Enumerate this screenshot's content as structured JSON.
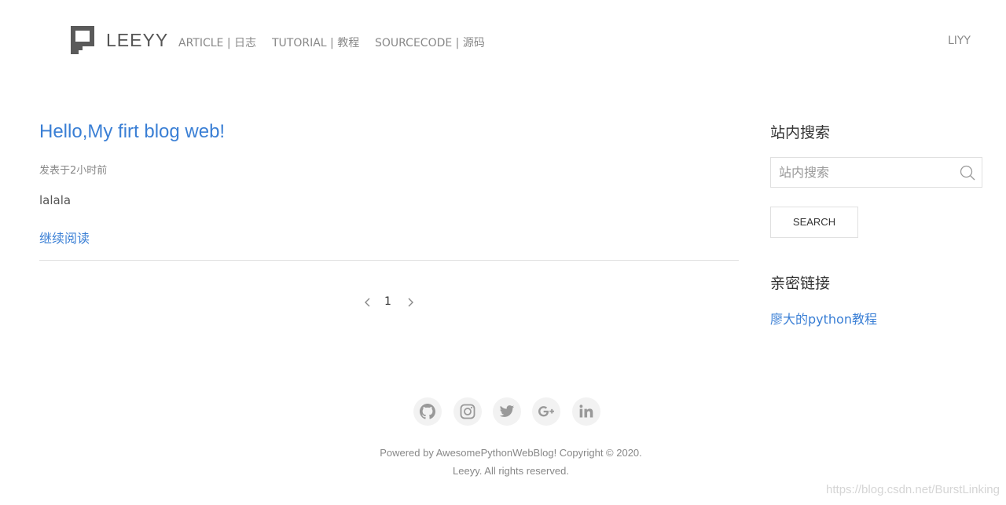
{
  "header": {
    "brand": "LEEYY",
    "nav": [
      {
        "label": "ARTICLE | 日志"
      },
      {
        "label": "TUTORIAL | 教程"
      },
      {
        "label": "SOURCECODE | 源码"
      }
    ],
    "user": "LIYY"
  },
  "article": {
    "title": "Hello,My firt blog web!",
    "meta": "发表于2小时前",
    "summary": "lalala",
    "read_more": "继续阅读"
  },
  "pagination": {
    "current": "1"
  },
  "sidebar": {
    "search_heading": "站内搜索",
    "search_placeholder": "站内搜索",
    "search_button": "SEARCH",
    "links_heading": "亲密链接",
    "links": [
      {
        "label": "廖大的python教程"
      }
    ]
  },
  "footer": {
    "social_icons": [
      "github-icon",
      "instagram-icon",
      "twitter-icon",
      "google-plus-icon",
      "linkedin-icon"
    ],
    "copyright_line1": "Powered by AwesomePythonWebBlog! Copyright © 2020.",
    "copyright_line2": "Leeyy. All rights reserved."
  },
  "watermark": "https://blog.csdn.net/BurstLinking",
  "colors": {
    "link": "#3a7fd5",
    "muted": "#888888",
    "icon": "#999999"
  }
}
